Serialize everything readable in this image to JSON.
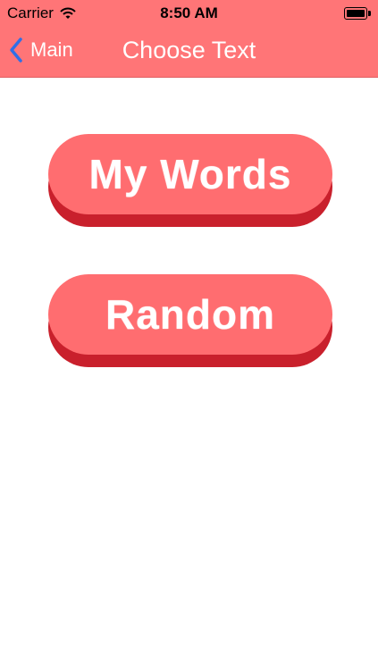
{
  "status_bar": {
    "carrier": "Carrier",
    "time": "8:50 AM",
    "battery_level": 1.0
  },
  "nav_bar": {
    "back_label": "Main",
    "title": "Choose Text"
  },
  "buttons": {
    "my_words": "My Words",
    "random": "Random"
  },
  "colors": {
    "header": "#ff7577",
    "button_face": "#ff6d70",
    "button_shadow": "#c9202c",
    "back_chevron": "#2f6fe6"
  },
  "icons": [
    "wifi-icon",
    "battery-icon",
    "back-chevron-icon"
  ]
}
